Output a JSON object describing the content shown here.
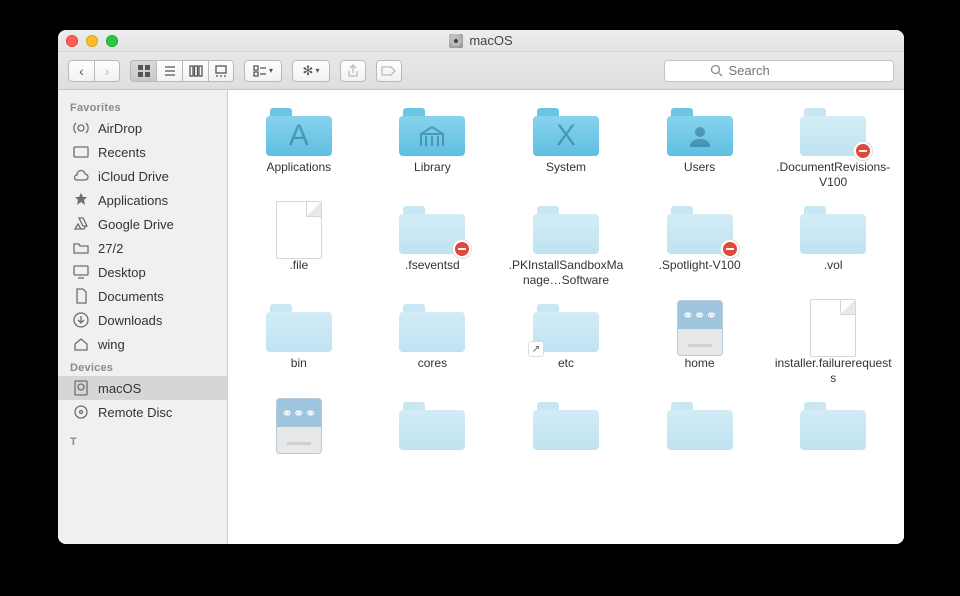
{
  "window": {
    "title": "macOS"
  },
  "search": {
    "placeholder": "Search"
  },
  "sidebar": {
    "sections": [
      {
        "title": "Favorites",
        "items": [
          {
            "id": "airdrop",
            "label": "AirDrop",
            "icon": "airdrop"
          },
          {
            "id": "recents",
            "label": "Recents",
            "icon": "recents"
          },
          {
            "id": "iclouddrive",
            "label": "iCloud Drive",
            "icon": "icloud"
          },
          {
            "id": "applications",
            "label": "Applications",
            "icon": "applications"
          },
          {
            "id": "googledrive",
            "label": "Google Drive",
            "icon": "gdrive"
          },
          {
            "id": "27-2",
            "label": "27/2",
            "icon": "folder"
          },
          {
            "id": "desktop",
            "label": "Desktop",
            "icon": "desktop"
          },
          {
            "id": "documents",
            "label": "Documents",
            "icon": "documents"
          },
          {
            "id": "downloads",
            "label": "Downloads",
            "icon": "downloads"
          },
          {
            "id": "wing",
            "label": "wing",
            "icon": "home"
          }
        ]
      },
      {
        "title": "Devices",
        "items": [
          {
            "id": "macos",
            "label": "macOS",
            "icon": "disk",
            "selected": true
          },
          {
            "id": "remotedisc",
            "label": "Remote Disc",
            "icon": "remotedisc"
          }
        ]
      }
    ],
    "truncated_section_prefix": "T"
  },
  "items": [
    {
      "label": "Applications",
      "type": "folder-sys",
      "glyph": "A"
    },
    {
      "label": "Library",
      "type": "folder-sys",
      "glyph": "library"
    },
    {
      "label": "System",
      "type": "folder-sys",
      "glyph": "X"
    },
    {
      "label": "Users",
      "type": "folder-sys",
      "glyph": "user"
    },
    {
      "label": ".DocumentRevisions-V100",
      "type": "folder-dim",
      "restricted": true
    },
    {
      "label": ".file",
      "type": "file"
    },
    {
      "label": ".fseventsd",
      "type": "folder-dim",
      "restricted": true
    },
    {
      "label": ".PKInstallSandboxManage…Software",
      "type": "folder-dim"
    },
    {
      "label": ".Spotlight-V100",
      "type": "folder-dim",
      "restricted": true
    },
    {
      "label": ".vol",
      "type": "folder-dim"
    },
    {
      "label": "bin",
      "type": "folder-dim"
    },
    {
      "label": "cores",
      "type": "folder-dim"
    },
    {
      "label": "etc",
      "type": "folder-dim",
      "alias": true
    },
    {
      "label": "home",
      "type": "netdrive"
    },
    {
      "label": "installer.failurerequests",
      "type": "file"
    },
    {
      "label": "",
      "type": "netdrive-partial"
    },
    {
      "label": "",
      "type": "folder-dim"
    },
    {
      "label": "",
      "type": "folder-dim"
    },
    {
      "label": "",
      "type": "folder-dim"
    },
    {
      "label": "",
      "type": "folder-dim"
    }
  ]
}
